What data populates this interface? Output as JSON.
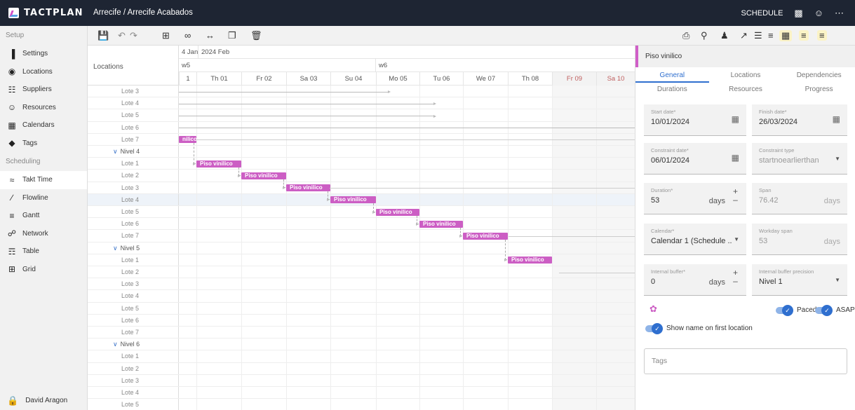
{
  "app": {
    "logo_text": "TACTPLAN",
    "project": "Arrecife / Arrecife Acabados",
    "mode": "SCHEDULE",
    "user": "David Aragon"
  },
  "sidebar": {
    "setup_label": "Setup",
    "setup_items": [
      {
        "label": "Settings",
        "icon": "stairs-icon"
      },
      {
        "label": "Locations",
        "icon": "location-pin-icon"
      },
      {
        "label": "Suppliers",
        "icon": "group-icon"
      },
      {
        "label": "Resources",
        "icon": "person-icon"
      },
      {
        "label": "Calendars",
        "icon": "calendar-icon"
      },
      {
        "label": "Tags",
        "icon": "tag-icon"
      }
    ],
    "scheduling_label": "Scheduling",
    "scheduling_items": [
      {
        "label": "Takt Time",
        "icon": "takt-icon",
        "active": true
      },
      {
        "label": "Flowline",
        "icon": "flowline-icon"
      },
      {
        "label": "Gantt",
        "icon": "gantt-icon"
      },
      {
        "label": "Network",
        "icon": "network-icon"
      },
      {
        "label": "Table",
        "icon": "table-icon"
      },
      {
        "label": "Grid",
        "icon": "grid-icon"
      }
    ]
  },
  "grid": {
    "locations_header": "Locations",
    "months": [
      {
        "label": "4 Jan"
      },
      {
        "label": "2024 Feb"
      }
    ],
    "weeks": [
      {
        "label": "w5"
      },
      {
        "label": "w6"
      }
    ],
    "days": [
      "1",
      "Th 01",
      "Fr 02",
      "Sa 03",
      "Su 04",
      "Mo 05",
      "Tu 06",
      "We 07",
      "Th 08",
      "Fr 09",
      "Sa 10"
    ],
    "rows": [
      {
        "type": "lote",
        "label": "Lote 3"
      },
      {
        "type": "lote",
        "label": "Lote 4"
      },
      {
        "type": "lote",
        "label": "Lote 5"
      },
      {
        "type": "lote",
        "label": "Lote 6"
      },
      {
        "type": "lote",
        "label": "Lote 7"
      },
      {
        "type": "nivel",
        "label": "Nivel 4"
      },
      {
        "type": "lote",
        "label": "Lote 1"
      },
      {
        "type": "lote",
        "label": "Lote 2"
      },
      {
        "type": "lote",
        "label": "Lote 3"
      },
      {
        "type": "lote",
        "label": "Lote 4",
        "selected": true
      },
      {
        "type": "lote",
        "label": "Lote 5"
      },
      {
        "type": "lote",
        "label": "Lote 6"
      },
      {
        "type": "lote",
        "label": "Lote 7"
      },
      {
        "type": "nivel",
        "label": "Nivel 5"
      },
      {
        "type": "lote",
        "label": "Lote 1"
      },
      {
        "type": "lote",
        "label": "Lote 2"
      },
      {
        "type": "lote",
        "label": "Lote 3"
      },
      {
        "type": "lote",
        "label": "Lote 4"
      },
      {
        "type": "lote",
        "label": "Lote 5"
      },
      {
        "type": "lote",
        "label": "Lote 6"
      },
      {
        "type": "lote",
        "label": "Lote 7"
      },
      {
        "type": "nivel",
        "label": "Nivel 6"
      },
      {
        "type": "lote",
        "label": "Lote 1"
      },
      {
        "type": "lote",
        "label": "Lote 2"
      },
      {
        "type": "lote",
        "label": "Lote 3"
      },
      {
        "type": "lote",
        "label": "Lote 4"
      },
      {
        "type": "lote",
        "label": "Lote 5"
      }
    ],
    "bars": [
      {
        "label": "nilico",
        "row": 4
      },
      {
        "label": "Piso vinilico",
        "row": 6
      },
      {
        "label": "Piso vinilico",
        "row": 7
      },
      {
        "label": "Piso vinilico",
        "row": 8
      },
      {
        "label": "Piso vinilico",
        "row": 9
      },
      {
        "label": "Piso vinilico",
        "row": 10
      },
      {
        "label": "Piso vinilico",
        "row": 11
      },
      {
        "label": "Piso vinilico",
        "row": 12
      },
      {
        "label": "Piso vinilico",
        "row": 14
      }
    ],
    "task_color": "#cc5ec4"
  },
  "panel": {
    "title": "Piso vinilico",
    "tabs_row1": [
      {
        "label": "General",
        "active": true
      },
      {
        "label": "Locations"
      },
      {
        "label": "Dependencies"
      }
    ],
    "tabs_row2": [
      {
        "label": "Durations"
      },
      {
        "label": "Resources"
      },
      {
        "label": "Progress"
      }
    ],
    "start_date_label": "Start date*",
    "start_date": "10/01/2024",
    "finish_date_label": "Finish date*",
    "finish_date": "26/03/2024",
    "constraint_date_label": "Constraint date*",
    "constraint_date": "06/01/2024",
    "constraint_type_label": "Constraint type",
    "constraint_type": "startnoearlierthan",
    "duration_label": "Duration*",
    "duration": "53",
    "duration_unit": "days",
    "span_label": "Span",
    "span": "76.42",
    "span_unit": "days",
    "calendar_label": "Calendar*",
    "calendar": "Calendar 1 (Schedule ...",
    "workday_span_label": "Workday span",
    "workday_span": "53",
    "workday_span_unit": "days",
    "buffer_label": "Internal buffer*",
    "buffer": "0",
    "buffer_unit": "days",
    "buffer_precision_label": "Internal buffer precision",
    "buffer_precision": "Nivel 1",
    "paced_label": "Paced",
    "asap_label": "ASAP",
    "show_name_label": "Show name on first location",
    "tags_placeholder": "Tags",
    "accent": "#2f6fcf"
  }
}
